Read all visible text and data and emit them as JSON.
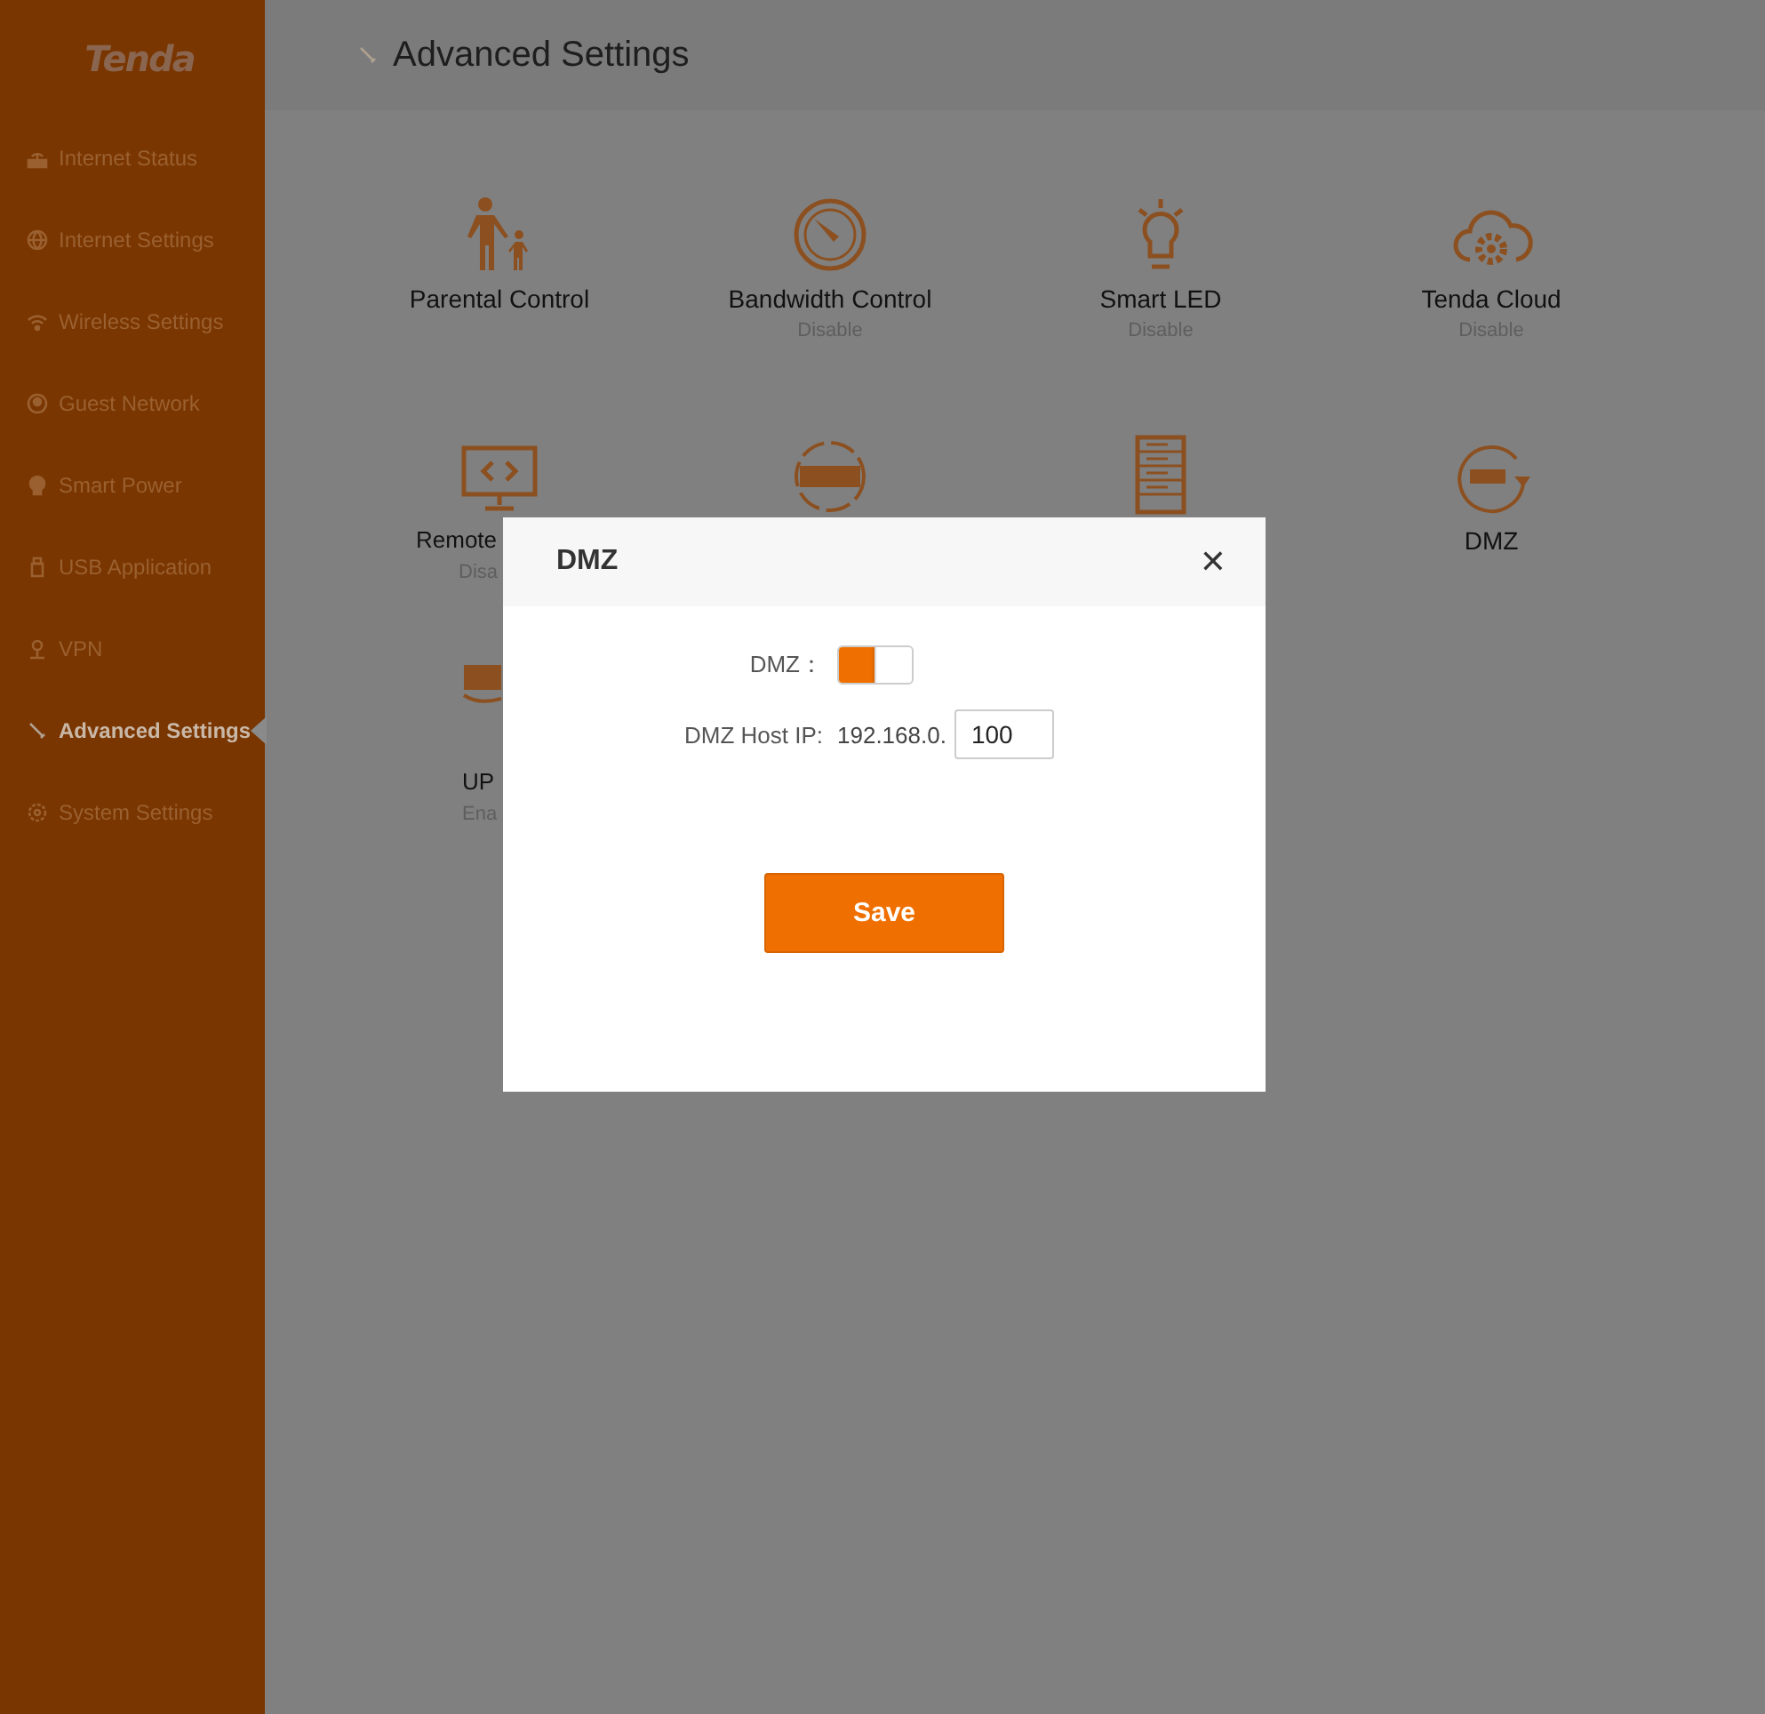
{
  "brand": {
    "logo": "Tenda"
  },
  "sidebar": {
    "items": [
      {
        "label": "Internet Status",
        "selected": false
      },
      {
        "label": "Internet Settings",
        "selected": false
      },
      {
        "label": "Wireless Settings",
        "selected": false
      },
      {
        "label": "Guest Network",
        "selected": false
      },
      {
        "label": "Smart Power",
        "selected": false
      },
      {
        "label": "USB Application",
        "selected": false
      },
      {
        "label": "VPN",
        "selected": false
      },
      {
        "label": "Advanced Settings",
        "selected": true
      },
      {
        "label": "System Settings",
        "selected": false
      }
    ]
  },
  "header": {
    "title": "Advanced Settings"
  },
  "tiles": [
    {
      "kind": "feature",
      "label": "Parental Control"
    },
    {
      "kind": "feature",
      "label": "Bandwidth Control",
      "status": "Disable"
    },
    {
      "kind": "feature",
      "label": "Smart LED",
      "status": "Disable"
    },
    {
      "kind": "feature",
      "label": "Tenda Cloud",
      "status": "Disable"
    },
    {
      "kind": "feature",
      "label": "Remote",
      "status": "Disa"
    },
    {
      "kind": "covered"
    },
    {
      "kind": "covered"
    },
    {
      "kind": "feature",
      "label": "DMZ"
    },
    {
      "kind": "feature",
      "label": "UP",
      "status": "Ena"
    }
  ],
  "dialog": {
    "title": "DMZ",
    "close": "✕",
    "toggle_label": "DMZ：",
    "toggle_on": true,
    "host_label": "DMZ Host IP:",
    "host_prefix": "192.168.0.",
    "host_value": "100",
    "save": "Save"
  }
}
